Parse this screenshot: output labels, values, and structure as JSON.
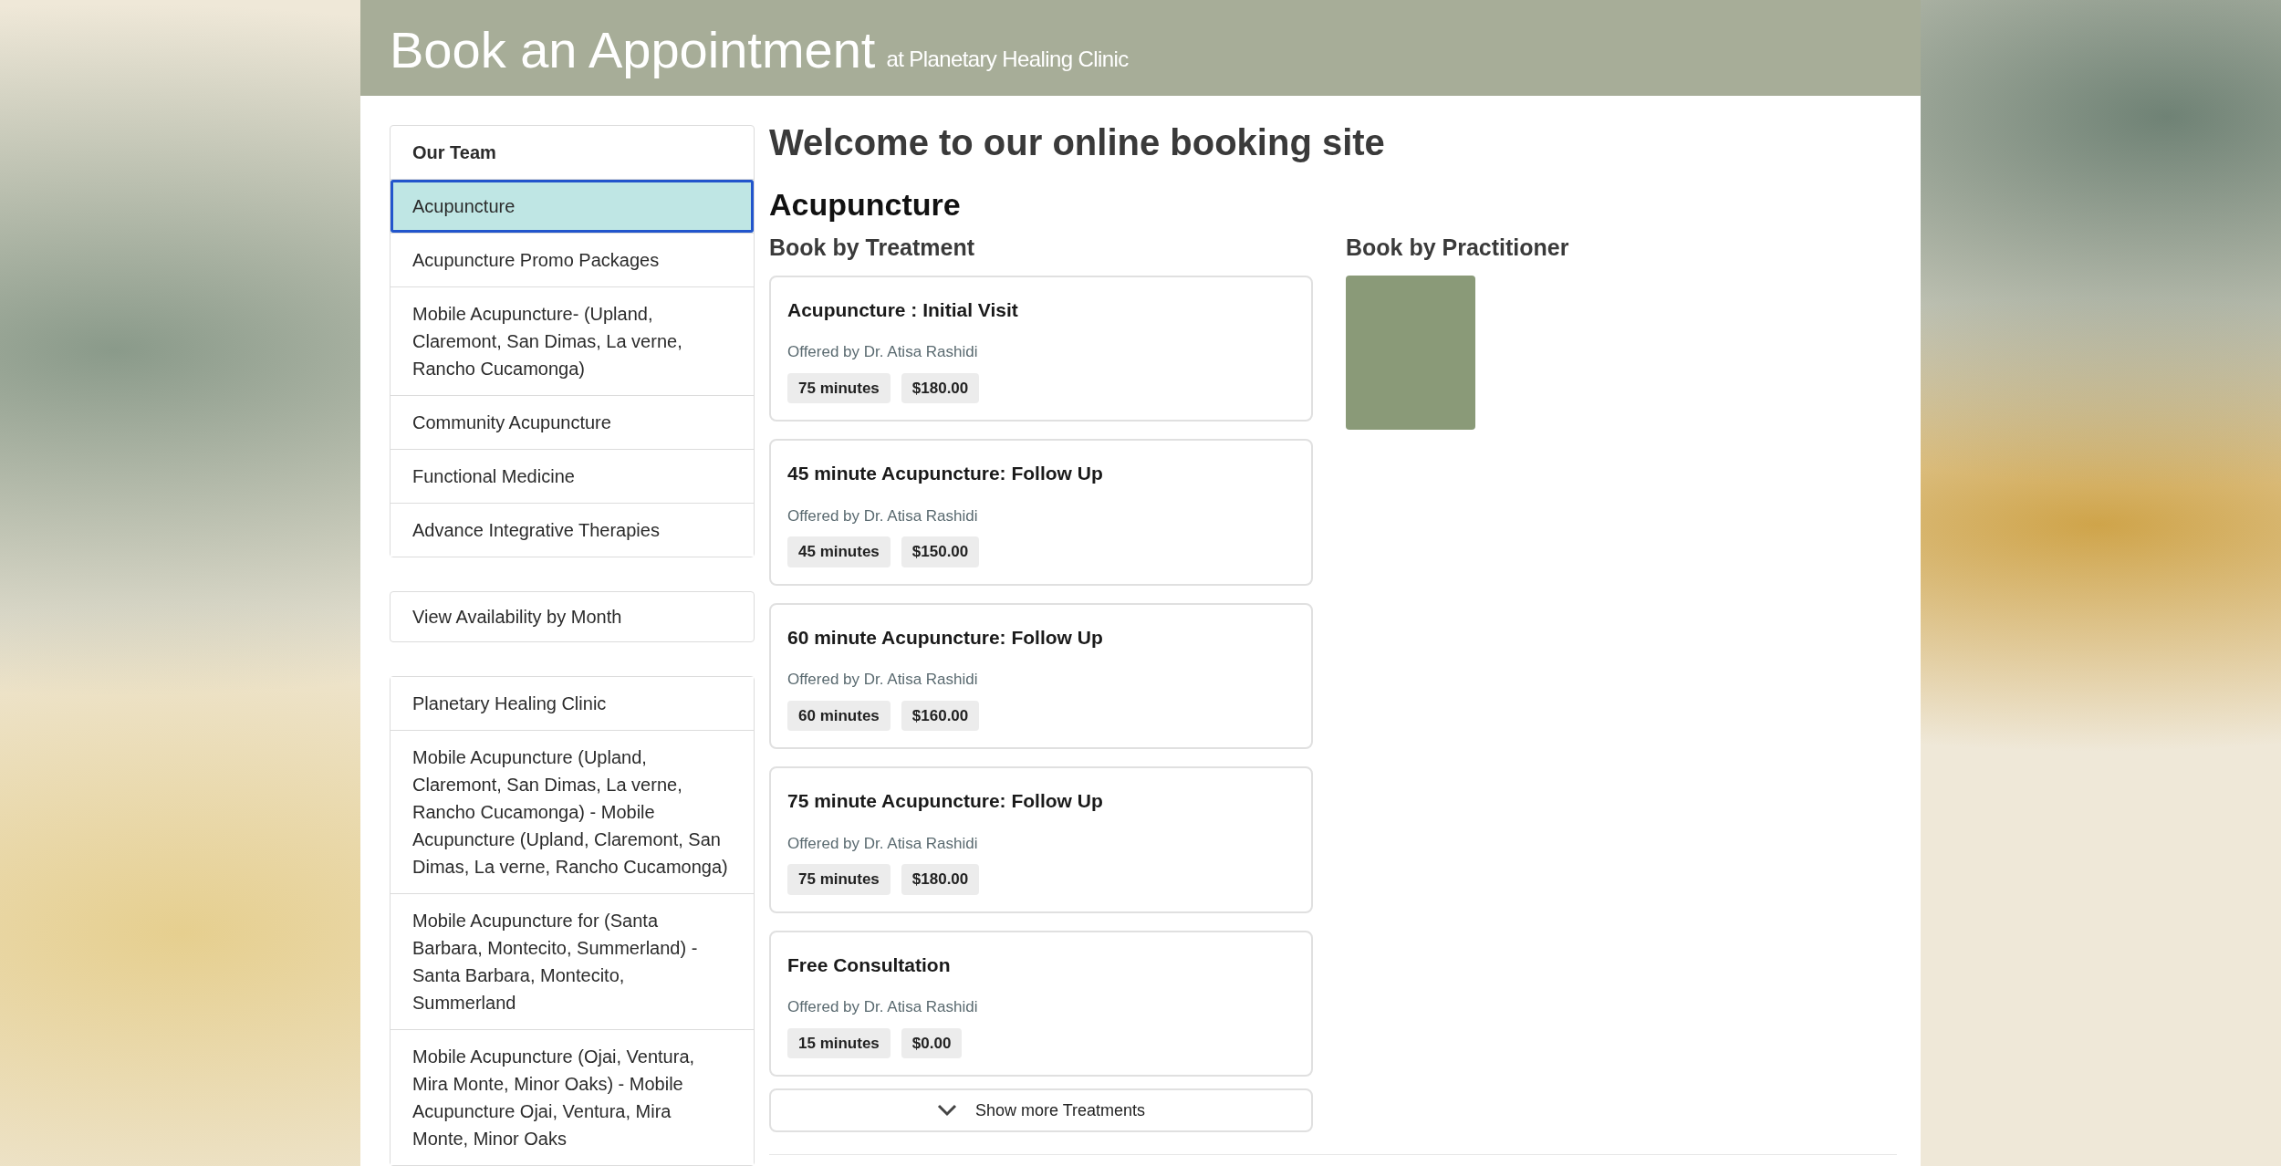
{
  "header": {
    "title": "Book an Appointment",
    "subtitle": "at Planetary Healing Clinic"
  },
  "sidebar": {
    "team": {
      "title": "Our Team",
      "items": [
        {
          "label": "Acupuncture",
          "selected": true
        },
        {
          "label": "Acupuncture Promo Packages",
          "selected": false
        },
        {
          "label": "Mobile Acupuncture- (Upland, Claremont, San Dimas, La verne, Rancho Cucamonga)",
          "selected": false
        },
        {
          "label": "Community Acupuncture",
          "selected": false
        },
        {
          "label": "Functional Medicine",
          "selected": false
        },
        {
          "label": "Advance Integrative Therapies",
          "selected": false
        }
      ]
    },
    "availability_link": "View Availability by Month",
    "locations": [
      {
        "label": "Planetary Healing Clinic",
        "selected": false
      },
      {
        "label": "Mobile Acupuncture (Upland, Claremont, San Dimas, La verne, Rancho Cucamonga) - Mobile Acupuncture (Upland, Claremont, San Dimas, La verne, Rancho Cucamonga)",
        "selected": false
      },
      {
        "label": "Mobile Acupuncture for (Santa Barbara, Montecito, Summerland) - Santa Barbara, Montecito, Summerland",
        "selected": false
      },
      {
        "label": "Mobile Acupuncture (Ojai, Ventura, Mira Monte, Minor Oaks) - Mobile Acupuncture Ojai, Ventura, Mira Monte, Minor Oaks",
        "selected": false
      }
    ]
  },
  "main": {
    "welcome": "Welcome to our online booking site",
    "category": "Acupuncture",
    "treatments_heading": "Book by Treatment",
    "treatments": [
      {
        "name": "Acupuncture : Initial Visit",
        "offered_by": "Offered by Dr. Atisa Rashidi",
        "duration": "75 minutes",
        "price": "$180.00"
      },
      {
        "name": "45 minute Acupuncture: Follow Up",
        "offered_by": "Offered by Dr. Atisa Rashidi",
        "duration": "45 minutes",
        "price": "$150.00"
      },
      {
        "name": "60 minute Acupuncture: Follow Up",
        "offered_by": "Offered by Dr. Atisa Rashidi",
        "duration": "60 minutes",
        "price": "$160.00"
      },
      {
        "name": "75 minute Acupuncture: Follow Up",
        "offered_by": "Offered by Dr. Atisa Rashidi",
        "duration": "75 minutes",
        "price": "$180.00"
      },
      {
        "name": "Free Consultation",
        "offered_by": "Offered by Dr. Atisa Rashidi",
        "duration": "15 minutes",
        "price": "$0.00"
      }
    ],
    "show_more": "Show more Treatments",
    "practitioners_heading": "Book by Practitioner"
  }
}
